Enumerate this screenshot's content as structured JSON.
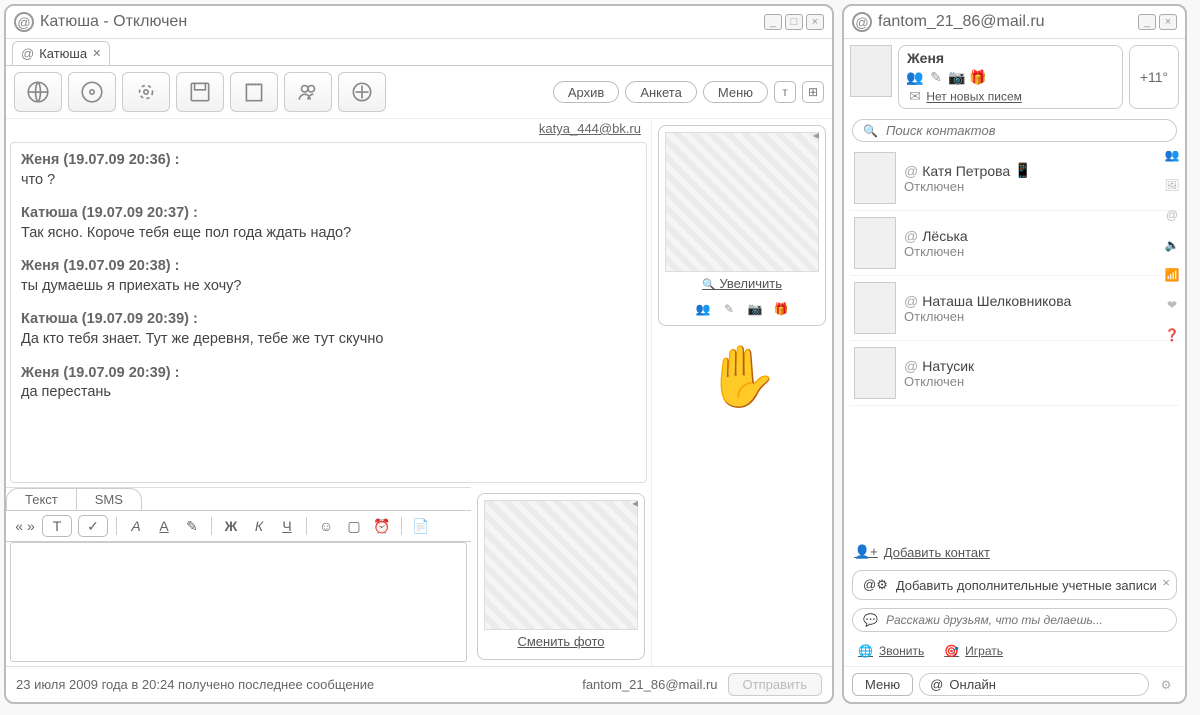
{
  "chat_window": {
    "title": "Катюша - Отключен",
    "tab_label": "Катюша",
    "toolbar": {
      "archive": "Архив",
      "profile": "Анкета",
      "menu": "Меню"
    },
    "contact_email": "katya_444@bk.ru",
    "messages": [
      {
        "hdr": "Женя (19.07.09 20:36) :",
        "body": "что ?"
      },
      {
        "hdr": "Катюша (19.07.09 20:37) :",
        "body": "Так ясно. Короче тебя еще пол года ждать надо?"
      },
      {
        "hdr": "Женя (19.07.09 20:38) :",
        "body": "ты думаешь я приехать не хочу?"
      },
      {
        "hdr": "Катюша (19.07.09 20:39) :",
        "body": "Да кто тебя знает. Тут же деревня, тебе же тут скучно"
      },
      {
        "hdr": "Женя (19.07.09 20:39) :",
        "body": "да перестань"
      }
    ],
    "enlarge": "Увеличить",
    "compose_tabs": {
      "text": "Текст",
      "sms": "SMS"
    },
    "change_photo": "Сменить фото",
    "status_line": "23 июля 2009 года в 20:24 получено последнее сообщение",
    "my_email": "fantom_21_86@mail.ru",
    "send": "Отправить"
  },
  "list_window": {
    "title": "fantom_21_86@mail.ru",
    "profile": {
      "name": "Женя",
      "mail_link": "Нет новых писем",
      "weather": "+11°"
    },
    "search_placeholder": "Поиск контактов",
    "contacts": [
      {
        "name": "Катя Петрова",
        "status": "Отключен",
        "mobile": true
      },
      {
        "name": "Лёська",
        "status": "Отключен",
        "mobile": false
      },
      {
        "name": "Наташа Шелковникова",
        "status": "Отключен",
        "mobile": false
      },
      {
        "name": "Натусик",
        "status": "Отключен",
        "mobile": false
      }
    ],
    "add_contact": "Добавить контакт",
    "add_account": "Добавить дополнительные учетные записи",
    "status_placeholder": "Расскажи друзьям, что ты делаешь...",
    "call": "Звонить",
    "play": "Играть",
    "menu": "Меню",
    "presence": "Онлайн"
  }
}
